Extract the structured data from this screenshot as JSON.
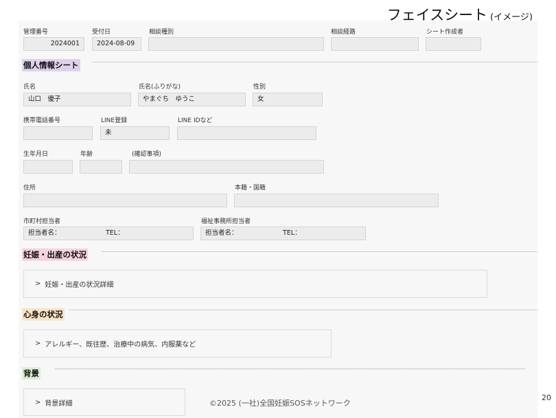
{
  "title": {
    "main": "フェイスシート",
    "sub": "(イメージ)"
  },
  "header": {
    "admin_no_label": "管理番号",
    "admin_no_value": "2024001",
    "received_label": "受付日",
    "received_value": "2024-08-09",
    "consult_type_label": "相談種別",
    "consult_type_value": "",
    "consult_route_label": "相談経路",
    "consult_route_value": "",
    "creator_label": "シート作成者",
    "creator_value": ""
  },
  "personal": {
    "heading": "個人情報シート",
    "heading_color": "#dcd3ea",
    "name_label": "氏名",
    "name_value": "山口　優子",
    "kana_label": "氏名(ふりがな)",
    "kana_value": "やまぐち　ゆうこ",
    "sex_label": "性別",
    "sex_value": "女",
    "phone_label": "携帯電話番号",
    "phone_value": "",
    "line_reg_label": "LINE登録",
    "line_reg_value": "未",
    "line_id_label": "LINE IDなど",
    "line_id_value": "",
    "dob_label": "生年月日",
    "dob_value": "",
    "age_label": "年齢",
    "age_value": "",
    "confirm_label": "(確認事項)",
    "confirm_value": "",
    "address_label": "住所",
    "address_value": "",
    "domicile_label": "本籍・国籍",
    "domicile_value": "",
    "city_staff_label": "市町村担当者",
    "city_staff_name": "担当者名：",
    "city_staff_tel": "TEL：",
    "welfare_staff_label": "福祉事務所担当者",
    "welfare_staff_name": "担当者名：",
    "welfare_staff_tel": "TEL："
  },
  "pregnancy": {
    "heading": "妊娠・出産の状況",
    "heading_color": "#f6d3de",
    "detail": "妊娠・出産の状況詳細"
  },
  "health": {
    "heading": "心身の状況",
    "heading_color": "#fbe3c8",
    "detail": "アレルギー、既往歴、治療中の病気、内服薬など"
  },
  "background": {
    "heading": "背景",
    "heading_color": "#d9eed2",
    "detail": "背景詳細"
  },
  "footer": {
    "copyright": "©2025 (一社)全国妊娠SOSネットワーク",
    "page_number": "20"
  }
}
